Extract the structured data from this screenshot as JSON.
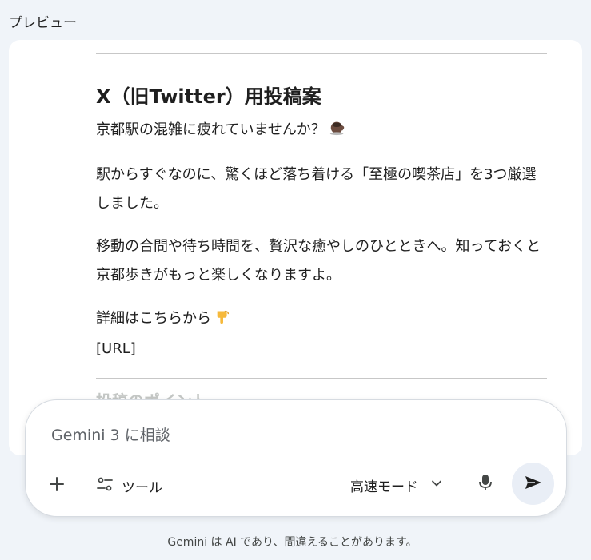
{
  "preview": {
    "label": "プレビュー"
  },
  "post": {
    "title": "X（旧Twitter）用投稿案",
    "paragraphs": [
      "京都駅の混雑に疲れていませんか？",
      "駅からすぐなのに、驚くほど落ち着ける「至極の喫茶店」を3つ厳選しました。",
      "移動の合間や待ち時間を、贅沢な癒やしのひとときへ。知っておくと京都歩きがもっと楽しくなりますよ。",
      "詳細はこちらから"
    ],
    "url": "[URL]",
    "next_heading": "投稿のポイント"
  },
  "composer": {
    "placeholder": "Gemini 3 に相談",
    "value": "",
    "tools_label": "ツール",
    "mode_label": "高速モード",
    "icons": [
      "plus-icon",
      "tools-icon",
      "chevron-down-icon",
      "mic-icon",
      "send-icon",
      "coffee-icon",
      "point-down-icon"
    ]
  },
  "footer": {
    "disclaimer": "Gemini は AI であり、間違えることがあります。"
  }
}
